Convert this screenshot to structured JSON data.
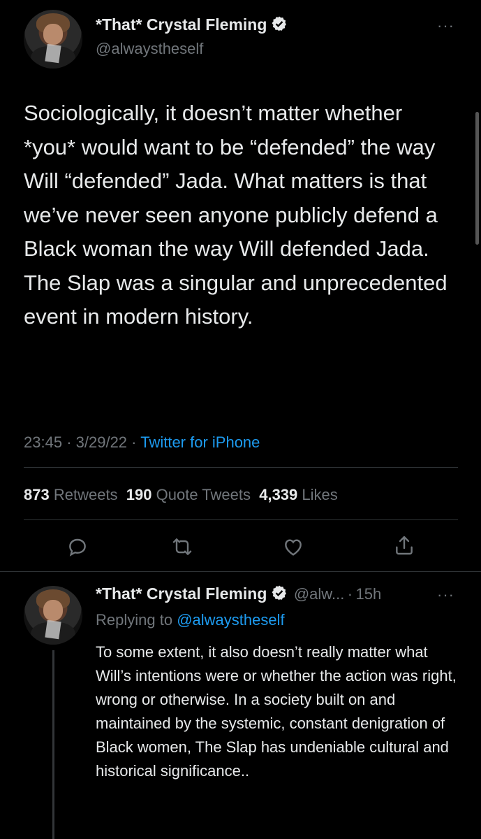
{
  "main_tweet": {
    "display_name": "*That* Crystal Fleming",
    "handle": "@alwaystheself",
    "text": "Sociologically, it doesn’t matter whether *you* would want to be “defended” the way Will “defended” Jada. What matters is that we’ve never seen anyone publicly defend a Black woman the way Will defended Jada. The Slap was a singular and unprecedented event in modern history.",
    "time": "23:45",
    "date": "3/29/22",
    "source": "Twitter for iPhone",
    "retweets_count": "873",
    "retweets_label": "Retweets",
    "quotes_count": "190",
    "quotes_label": "Quote Tweets",
    "likes_count": "4,339",
    "likes_label": "Likes"
  },
  "reply_tweet": {
    "display_name": "*That* Crystal Fleming",
    "handle": "@alw...",
    "age": "15h",
    "replying_prefix": "Replying to",
    "replying_to": "@alwaystheself",
    "text": "To some extent, it also doesn’t really matter what Will’s intentions were or whether the action was right, wrong or otherwise. In a society built on and maintained by the systemic, constant denigration of Black women, The Slap has undeniable cultural and historical significance.."
  },
  "separators": {
    "dot": "·"
  },
  "more_glyph": "···",
  "icons": [
    "verified-badge-icon",
    "more-icon",
    "reply-icon",
    "retweet-icon",
    "like-icon",
    "share-icon"
  ],
  "colors": {
    "background": "#000000",
    "text": "#e7e9ea",
    "secondary": "#71767b",
    "link": "#1d9bf0",
    "divider": "#2f3336"
  }
}
